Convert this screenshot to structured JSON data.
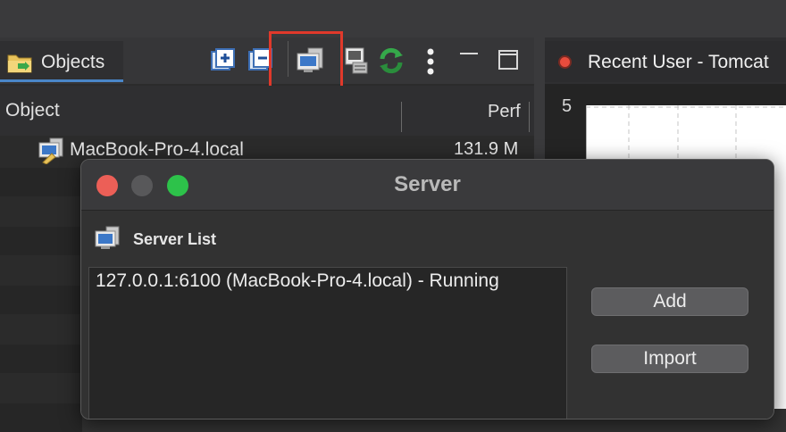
{
  "objects_view": {
    "tab_label": "Objects",
    "columns": [
      "Object",
      "Perf"
    ],
    "rows": [
      {
        "name": "MacBook-Pro-4.local",
        "perf": "131.9 M"
      }
    ]
  },
  "chart_view": {
    "title": "Recent User - Tomcat",
    "y_tick_top": "5"
  },
  "dialog": {
    "title": "Server",
    "section_label": "Server List",
    "servers": [
      "127.0.0.1:6100 (MacBook-Pro-4.local) - Running"
    ],
    "buttons": {
      "add": "Add",
      "import": "Import"
    }
  },
  "colors": {
    "highlight": "#e0392b",
    "tab_underline": "#4a86c8",
    "close_light": "#ec5f57",
    "zoom_light": "#2dc24a"
  }
}
